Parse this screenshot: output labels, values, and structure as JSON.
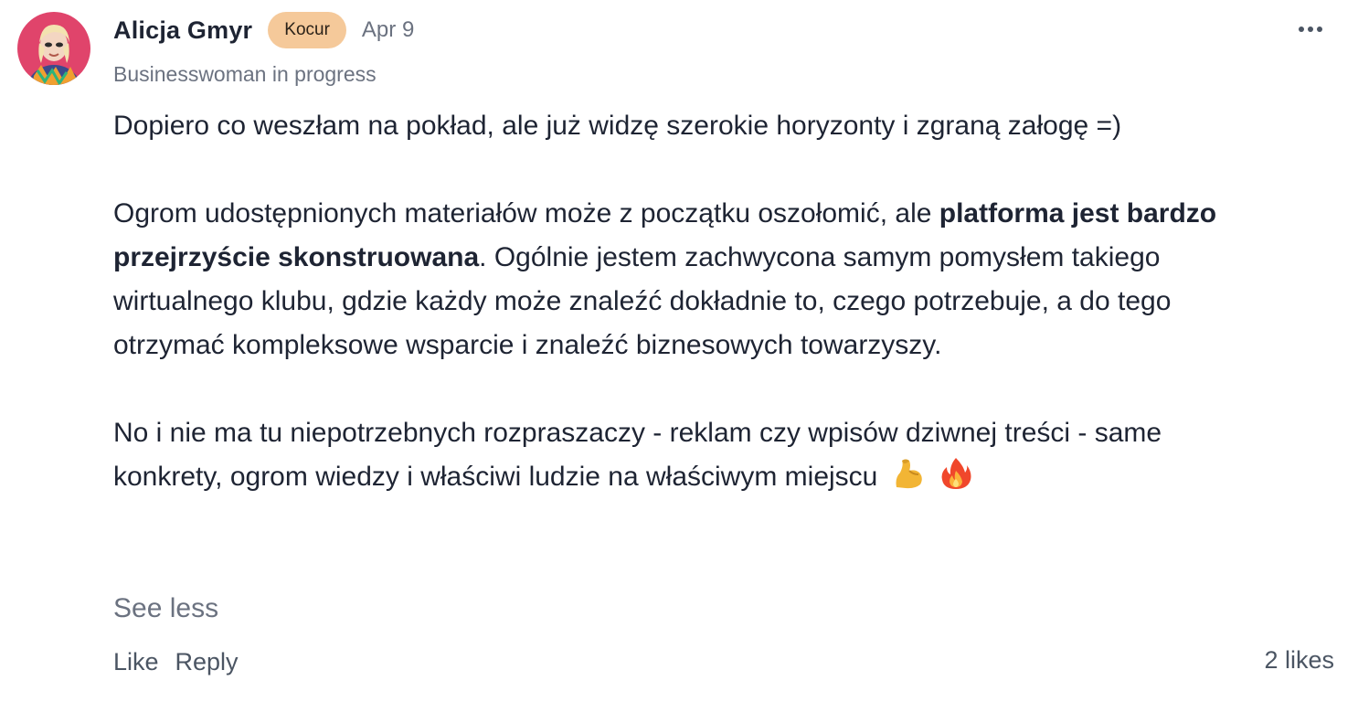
{
  "post": {
    "author": {
      "name": "Alicja Gmyr",
      "badge": "Kocur",
      "headline": "Businesswoman in progress",
      "avatar_bg": "#e0446b"
    },
    "date": "Apr 9",
    "more_icon": "more-horizontal-icon",
    "body": {
      "paragraph1": "Dopiero co weszłam na pokład, ale już widzę szerokie horyzonty i zgraną załogę =)",
      "paragraph2_before": "Ogrom udostępnionych materiałów może z początku oszołomić, ale ",
      "paragraph2_bold": "platforma jest bardzo przejrzyście skonstruowana",
      "paragraph2_after": ". Ogólnie jestem zachwycona samym pomysłem takiego wirtualnego klubu, gdzie każdy może znaleźć dokładnie to, czego potrzebuje, a do tego otrzymać kompleksowe wsparcie i znaleźć biznesowych towarzyszy.",
      "paragraph3": "No i nie ma tu niepotrzebnych rozpraszaczy - reklam czy wpisów dziwnej treści - same konkrety, ogrom wiedzy i właściwi ludzie na właściwym miejscu",
      "emojis": [
        "flexed-biceps-icon",
        "fire-icon"
      ]
    },
    "see_less_label": "See less",
    "actions": {
      "like_label": "Like",
      "reply_label": "Reply"
    },
    "likes_count": "2 likes",
    "colors": {
      "badge_bg": "#f5c99a",
      "text_primary": "#1e2433",
      "text_muted": "#6b7280"
    }
  }
}
